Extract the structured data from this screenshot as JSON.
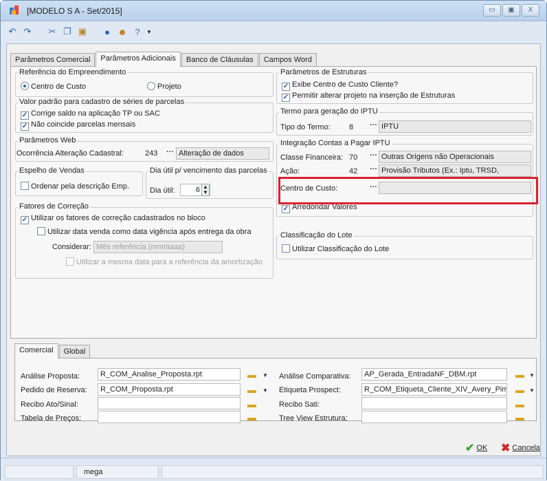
{
  "window": {
    "title": "[MODELO S A - Set/2015]",
    "controls": {
      "minimize": "▭",
      "maximize": "▣",
      "close": "X"
    }
  },
  "toolbar": {
    "icons": [
      "back-icon",
      "forward-icon",
      "cut-icon",
      "copy-icon",
      "paste-icon",
      "info-icon",
      "user-icon",
      "help-icon"
    ]
  },
  "tabs": [
    "Parâmetros Comercial",
    "Parâmetros Adicionais",
    "Banco de Cláusulas",
    "Campos Word"
  ],
  "left": {
    "referencia": {
      "label": "Referência do Empreendimento",
      "opt1": "Centro de Custo",
      "opt2": "Projeto"
    },
    "valor_padrao": {
      "label": "Valor padrão para cadastro de séries de parcelas",
      "chk1": "Corrige saldo na aplicação TP ou SAC",
      "chk2": "Não coincide parcelas mensais"
    },
    "web": {
      "label": "Parâmetros Web",
      "field_label": "Ocorrência Alteração Cadastral:",
      "code": "243",
      "desc": "Alteração de dados"
    },
    "espelho": {
      "label": "Espelho de Vendas",
      "chk": "Ordenar pela descrição Emp."
    },
    "dia_util": {
      "label": "Dia útil p/ vencimento das parcelas",
      "field_label": "Dia útil:",
      "value": "6"
    },
    "fatores": {
      "label": "Fatores de Correção",
      "chk1": "Utilizar os fatores de correção cadastrados no bloco",
      "chk2": "Utilizar data venda como data vigência após entrega da obra",
      "considerar_label": "Considerar:",
      "considerar_value": "Mês referência (mm/aaaa)",
      "chk3": "Utilizar a mesma data para a referência da amortização"
    }
  },
  "right": {
    "estruturas": {
      "label": "Parâmetros de Estruturas",
      "chk1": "Exibe Centro de Custo Cliente?",
      "chk2": "Permitir alterar projeto na inserção de Estruturas"
    },
    "iptu_termo": {
      "label": "Termo para geração do IPTU",
      "field_label": "Tipo do Termo:",
      "code": "8",
      "desc": "IPTU"
    },
    "integracao": {
      "label": "Integração Contas a Pagar IPTU",
      "classe_label": "Classe Financeira:",
      "classe_code": "70",
      "classe_desc": "Outras Origens não Operacionais",
      "acao_label": "Ação:",
      "acao_code": "42",
      "acao_desc": "Provisão Tributos (Ex.: Iptu, TRSD,",
      "centro_label": "Centro de Custo:",
      "arredondar": "Arredondar Valores"
    },
    "lote": {
      "label": "Classificação do Lote",
      "chk": "Utilizar Classificação do Lote"
    }
  },
  "bottom": {
    "tabs": [
      "Comercial",
      "Global"
    ],
    "left_fields": [
      {
        "label": "Análise Proposta:",
        "value": "R_COM_Analise_Proposta.rpt"
      },
      {
        "label": "Pedido de Reserva:",
        "value": "R_COM_Proposta.rpt"
      },
      {
        "label": "Recibo Ato/Sinal:",
        "value": ""
      },
      {
        "label": "Tabela de Preços:",
        "value": ""
      }
    ],
    "right_fields": [
      {
        "label": "Análise Comparativa:",
        "value": "AP_Gerada_EntradaNF_DBM.rpt"
      },
      {
        "label": "Etiqueta Prospect:",
        "value": "R_COM_Etiqueta_Cliente_XIV_Avery_Pim"
      },
      {
        "label": "Recibo Sati:",
        "value": ""
      },
      {
        "label": "Tree View Estrutura:",
        "value": ""
      }
    ]
  },
  "buttons": {
    "ok": "OK",
    "cancel": "Cancela"
  },
  "status": {
    "user": "mega"
  },
  "colors": {
    "highlight": "#d9212f",
    "ok_green": "#3aa335",
    "cancel_red": "#d02a2a"
  }
}
